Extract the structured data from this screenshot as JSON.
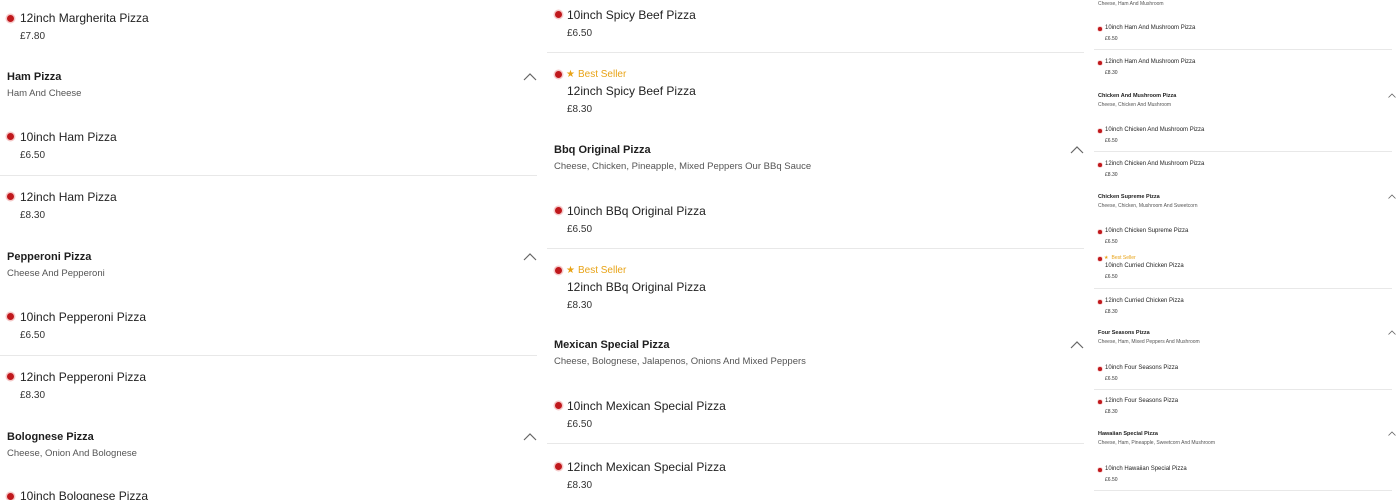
{
  "colA": {
    "items": [
      {
        "name": "12inch Margherita Pizza",
        "price": "£7.80"
      },
      {
        "name": "10inch Ham Pizza",
        "price": "£6.50"
      },
      {
        "name": "12inch Ham Pizza",
        "price": "£8.30"
      },
      {
        "name": "10inch Pepperoni Pizza",
        "price": "£6.50"
      },
      {
        "name": "12inch Pepperoni Pizza",
        "price": "£8.30"
      },
      {
        "name": "10inch Bolognese Pizza"
      }
    ],
    "categories": [
      {
        "title": "Ham Pizza",
        "desc": "Ham And Cheese"
      },
      {
        "title": "Pepperoni Pizza",
        "desc": "Cheese And Pepperoni"
      },
      {
        "title": "Bolognese Pizza",
        "desc": "Cheese, Onion And Bolognese"
      }
    ]
  },
  "colB": {
    "items": [
      {
        "name": "10inch Spicy Beef Pizza",
        "price": "£6.50"
      },
      {
        "name": "12inch Spicy Beef Pizza",
        "price": "£8.30",
        "badge": "Best Seller"
      },
      {
        "name": "10inch BBq Original Pizza",
        "price": "£6.50"
      },
      {
        "name": "12inch BBq Original Pizza",
        "price": "£8.30",
        "badge": "Best Seller"
      },
      {
        "name": "10inch Mexican Special Pizza",
        "price": "£6.50"
      },
      {
        "name": "12inch Mexican Special Pizza",
        "price": "£8.30"
      }
    ],
    "categories": [
      {
        "title": "Bbq Original Pizza",
        "desc": "Cheese, Chicken, Pineapple, Mixed Peppers Our BBq Sauce"
      },
      {
        "title": "Mexican Special Pizza",
        "desc": "Cheese, Bolognese, Jalapenos, Onions And Mixed Peppers"
      }
    ]
  },
  "colC": {
    "top_desc": "Cheese, Ham And Mushroom",
    "items": [
      {
        "name": "10inch Ham And Mushroom Pizza",
        "price": "£6.50"
      },
      {
        "name": "12inch Ham And Mushroom Pizza",
        "price": "£8.30"
      },
      {
        "name": "10inch Chicken And Mushroom Pizza",
        "price": "£6.50"
      },
      {
        "name": "12inch Chicken And Mushroom Pizza",
        "price": "£8.30"
      },
      {
        "name": "10inch Chicken Supreme Pizza",
        "price": "£6.50"
      },
      {
        "name": "10inch Curried Chicken Pizza",
        "price": "£6.50",
        "badge": "Best Seller"
      },
      {
        "name": "12inch Curried Chicken Pizza",
        "price": "£8.30"
      },
      {
        "name": "10inch Four Seasons Pizza",
        "price": "£6.50"
      },
      {
        "name": "12inch Four Seasons Pizza",
        "price": "£8.30"
      },
      {
        "name": "10inch Hawaiian Special Pizza",
        "price": "£6.50"
      }
    ],
    "categories": [
      {
        "title": "Chicken And Mushroom Pizza",
        "desc": "Cheese, Chicken And Mushroom"
      },
      {
        "title": "Chicken Supreme Pizza",
        "desc": "Cheese, Chicken, Mushroom And Sweetcorn"
      },
      {
        "title": "Four Seasons Pizza",
        "desc": "Cheese, Ham, Mixed Peppers And Mushroom"
      },
      {
        "title": "Hawaiian Special Pizza",
        "desc": "Cheese, Ham, Pineapple, Sweetcorn And Mushroom"
      }
    ]
  },
  "icons": {
    "dot": "item-dot-icon",
    "star": "star-icon",
    "chevron": "chevron-up-icon"
  },
  "colors": {
    "accent": "#c0181c",
    "badge": "#e8a317"
  }
}
